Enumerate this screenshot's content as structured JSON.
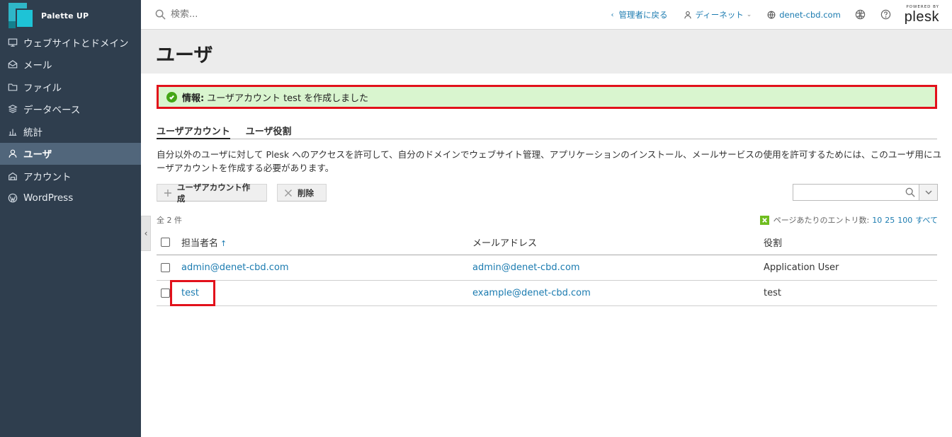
{
  "sidebar": {
    "brand": "Palette UP",
    "items": [
      {
        "label": "ウェブサイトとドメイン",
        "icon": "monitor-icon"
      },
      {
        "label": "メール",
        "icon": "mail-icon"
      },
      {
        "label": "ファイル",
        "icon": "folder-icon"
      },
      {
        "label": "データベース",
        "icon": "database-icon"
      },
      {
        "label": "統計",
        "icon": "chart-icon"
      },
      {
        "label": "ユーザ",
        "icon": "user-icon"
      },
      {
        "label": "アカウント",
        "icon": "account-icon"
      },
      {
        "label": "WordPress",
        "icon": "wordpress-icon"
      }
    ],
    "active_index": 5
  },
  "topbar": {
    "search_placeholder": "検索...",
    "back_to_admin": "管理者に戻る",
    "user_name": "ディーネット",
    "domain": "denet-cbd.com",
    "powered_by": "POWERED BY",
    "plesk": "plesk"
  },
  "page": {
    "title": "ユーザ",
    "info_label": "情報:",
    "info_text": "ユーザアカウント test を作成しました",
    "tabs": [
      "ユーザアカウント",
      "ユーザ役割"
    ],
    "description": "自分以外のユーザに対して Plesk へのアクセスを許可して、自分のドメインでウェブサイト管理、アプリケーションのインストール、メールサービスの使用を許可するためには、このユーザ用にユーザアカウントを作成する必要があります。",
    "create_button": "ユーザアカウント作成",
    "delete_button": "削除",
    "total": "全 2 件",
    "per_page_label": "ページあたりのエントリ数:",
    "per_page_options": [
      "10",
      "25",
      "100",
      "すべて"
    ]
  },
  "table": {
    "columns": [
      "担当者名",
      "メールアドレス",
      "役割"
    ],
    "sort_indicator": "↑",
    "rows": [
      {
        "name": "admin@denet-cbd.com",
        "email": "admin@denet-cbd.com",
        "role": "Application User"
      },
      {
        "name": "test",
        "email": "example@denet-cbd.com",
        "role": "test"
      }
    ]
  }
}
